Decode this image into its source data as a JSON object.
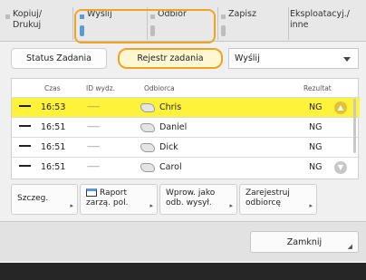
{
  "tabs": [
    {
      "label": "Kopiuj/ Drukuj",
      "active": false
    },
    {
      "label": "Wyślij",
      "active": true
    },
    {
      "label": "Odbiór",
      "active": false
    },
    {
      "label": "Zapisz",
      "active": false
    },
    {
      "label": "Eksploatacyj./ inne",
      "active": false
    }
  ],
  "subtabs": {
    "status": "Status Zadania",
    "log": "Rejestr zadania"
  },
  "filter": {
    "selected": "Wyślij"
  },
  "table": {
    "headers": {
      "time": "Czas",
      "id": "ID wydz.",
      "dest": "Odbiorca",
      "result": "Rezultat"
    },
    "rows": [
      {
        "time": "16:53",
        "id": "-------",
        "dest": "Chris",
        "result": "NG",
        "selected": true
      },
      {
        "time": "16:51",
        "id": "-------",
        "dest": "Daniel",
        "result": "NG",
        "selected": false
      },
      {
        "time": "16:51",
        "id": "-------",
        "dest": "Dick",
        "result": "NG",
        "selected": false
      },
      {
        "time": "16:51",
        "id": "-------",
        "dest": "Carol",
        "result": "NG",
        "selected": false
      }
    ]
  },
  "actions": {
    "details": "Szczeg.",
    "report": "Raport zarzą. pol.",
    "set_as_sent": "Wprow. jako odb. wysył.",
    "register_recipient": "Zarejestruj odbiorcę"
  },
  "close": "Zamknij",
  "colors": {
    "accent": "#f2a21e",
    "selected_row": "#fff23a",
    "active_indicator": "#5a9bd5"
  }
}
